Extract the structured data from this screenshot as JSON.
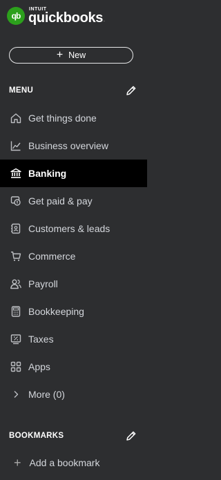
{
  "brand": {
    "mark": "qb",
    "intuit": "INTUIT",
    "name": "quickbooks",
    "tm": "."
  },
  "new_button": {
    "icon": "plus-icon",
    "label": "New"
  },
  "menu": {
    "title": "MENU",
    "edit_icon": "pencil-icon",
    "items": [
      {
        "label": "Get things done",
        "icon": "home-icon",
        "active": false
      },
      {
        "label": "Business overview",
        "icon": "trend-chart-icon",
        "active": false
      },
      {
        "label": "Banking",
        "icon": "bank-icon",
        "active": true
      },
      {
        "label": "Get paid & pay",
        "icon": "payment-card-icon",
        "active": false
      },
      {
        "label": "Customers & leads",
        "icon": "contact-card-icon",
        "active": false
      },
      {
        "label": "Commerce",
        "icon": "cart-icon",
        "active": false
      },
      {
        "label": "Payroll",
        "icon": "people-icon",
        "active": false
      },
      {
        "label": "Bookkeeping",
        "icon": "calculator-icon",
        "active": false
      },
      {
        "label": "Taxes",
        "icon": "tax-form-icon",
        "active": false
      },
      {
        "label": "Apps",
        "icon": "apps-grid-icon",
        "active": false
      },
      {
        "label": "More (0)",
        "icon": "chevron-right-icon",
        "active": false
      }
    ]
  },
  "bookmarks": {
    "title": "BOOKMARKS",
    "edit_icon": "pencil-icon",
    "add_label": "Add a bookmark",
    "add_icon": "plus-icon"
  },
  "colors": {
    "background": "#2d2e30",
    "active_background": "#000000",
    "brand_green": "#2ca01c",
    "text": "#d4d7dc"
  }
}
